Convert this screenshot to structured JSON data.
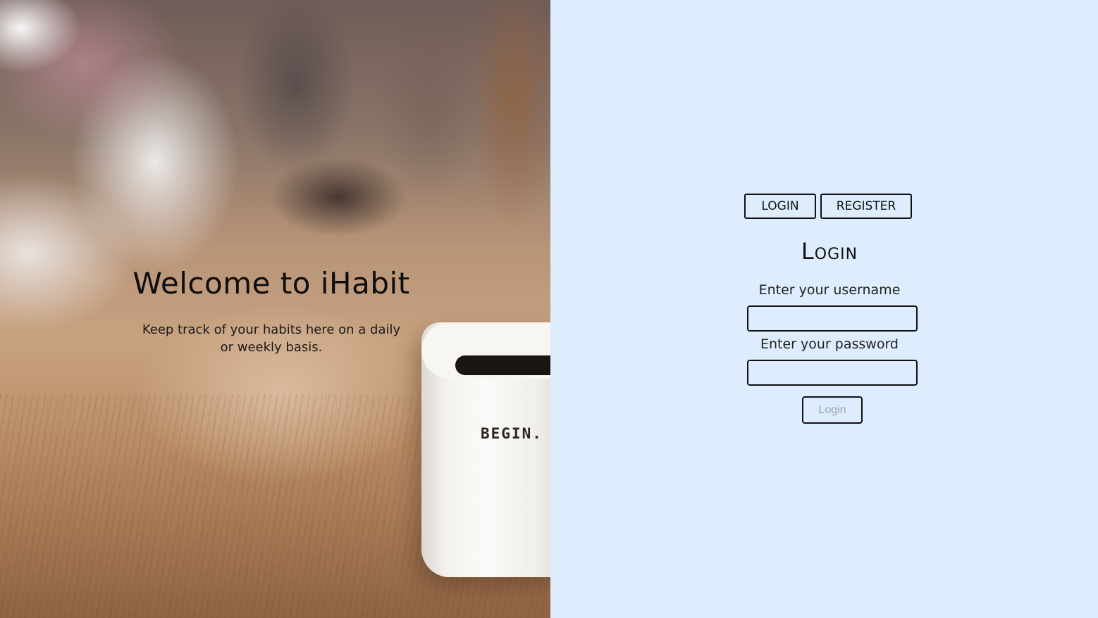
{
  "hero": {
    "title": "Welcome to iHabit",
    "subtitle": "Keep track of your habits here on a daily or weekly basis.",
    "mug_text": "BEGIN."
  },
  "auth": {
    "tabs": {
      "login": "LOGIN",
      "register": "REGISTER"
    },
    "form_title": "Login",
    "username_label": "Enter your username",
    "username_value": "",
    "password_label": "Enter your password",
    "password_value": "",
    "submit_label": "Login"
  },
  "colors": {
    "auth_background": "#ddedfd",
    "border": "#111111",
    "submit_text": "#9aa3ad"
  }
}
